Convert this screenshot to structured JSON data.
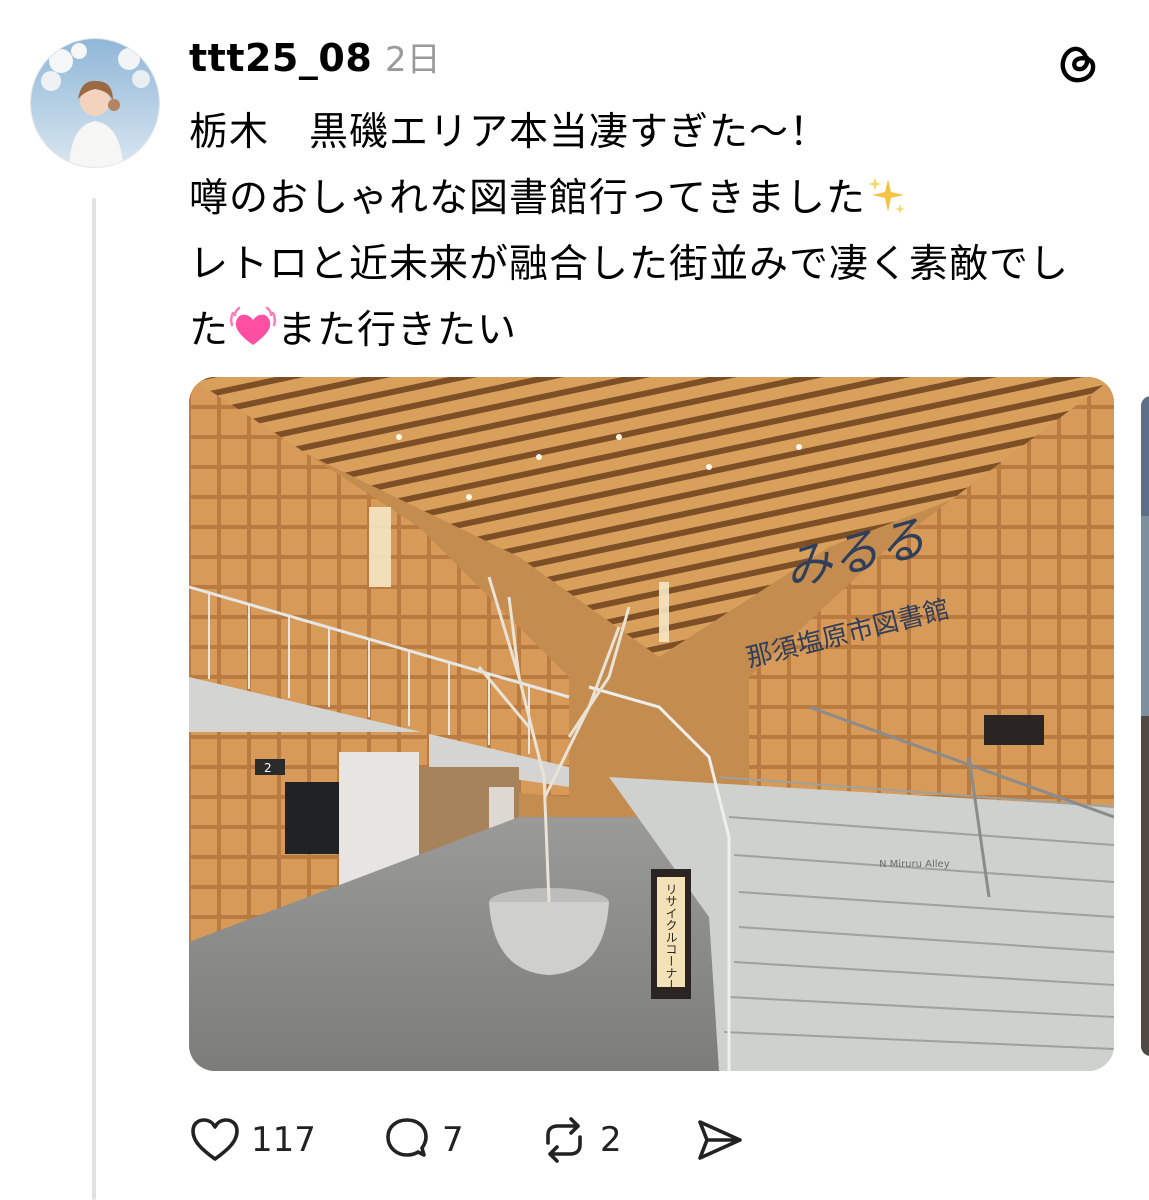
{
  "post": {
    "username": "ttt25_08",
    "time": "2日",
    "line1": "栃木　黒磯エリア本当凄すぎた〜！",
    "line2": "噂のおしゃれな図書館行ってきました",
    "line3": "レトロと近未来が融合した街並みで凄く素敵でし",
    "line4a": "た",
    "line4b": "また行きたい",
    "emoji_sparkles": "sparkles-emoji",
    "emoji_heart": "growing-heart-emoji"
  },
  "photo": {
    "sign_main": "みるる",
    "sign_sub": "那須塩原市図書館",
    "recycle_sign": "リサイクルコーナー",
    "floor_sign": "2",
    "watermark": "N Miruru Alley"
  },
  "actions": {
    "likes": "117",
    "replies": "7",
    "reposts": "2",
    "icons": [
      "heart-icon",
      "comment-icon",
      "repost-icon",
      "share-icon"
    ]
  },
  "colors": {
    "text": "#000000",
    "muted": "#9a9a9a",
    "thread_line": "#e2e2e2",
    "wood": "#c98d4a",
    "stairs": "#c9cbc8",
    "heart_emoji": "#ff4fa3",
    "sparkle": "#f6c445"
  }
}
